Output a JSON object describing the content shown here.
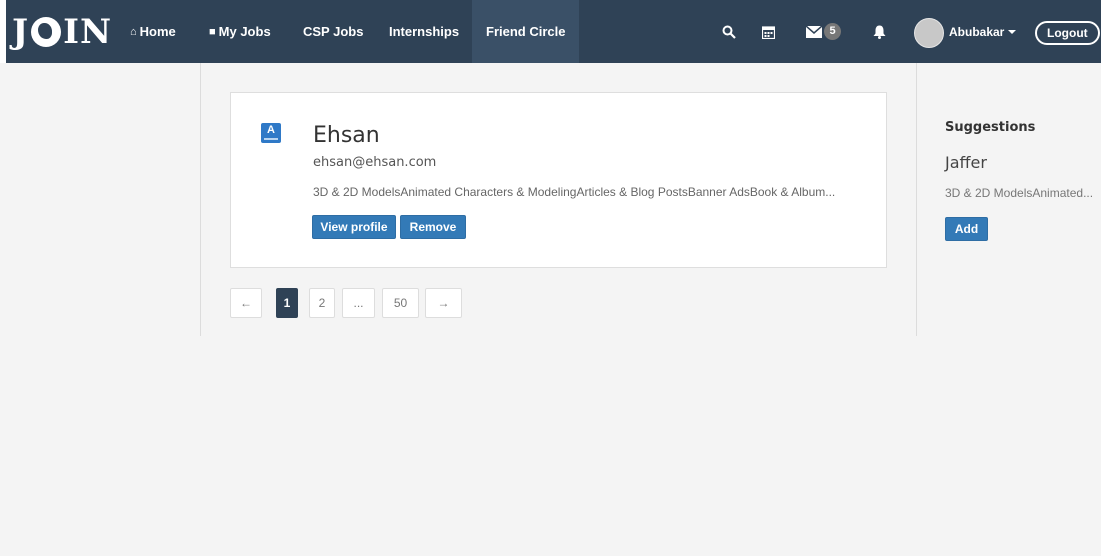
{
  "brand": {
    "logo_left": "J",
    "logo_right": "IN"
  },
  "nav": {
    "home": "Home",
    "my_jobs": "My Jobs",
    "csp_jobs": "CSP Jobs",
    "internships": "Internships",
    "friend_circle": "Friend Circle"
  },
  "toolbar": {
    "messages_count": "5"
  },
  "user": {
    "name": "Abubakar",
    "logout": "Logout"
  },
  "friend": {
    "name": "Ehsan",
    "email": "ehsan@ehsan.com",
    "skills": "3D & 2D ModelsAnimated Characters & ModelingArticles & Blog PostsBanner AdsBook & Album...",
    "view_profile": "View profile",
    "remove": "Remove"
  },
  "pagination": {
    "prev": "←",
    "pages": [
      "1",
      "2",
      "...",
      "50"
    ],
    "next": "→",
    "current": "1"
  },
  "suggestions": {
    "title": "Suggestions",
    "name": "Jaffer",
    "skills": "3D & 2D ModelsAnimated...",
    "add": "Add"
  },
  "colors": {
    "navbar": "#2f4256",
    "primary": "#337ab7",
    "background": "#f4f4f4"
  }
}
